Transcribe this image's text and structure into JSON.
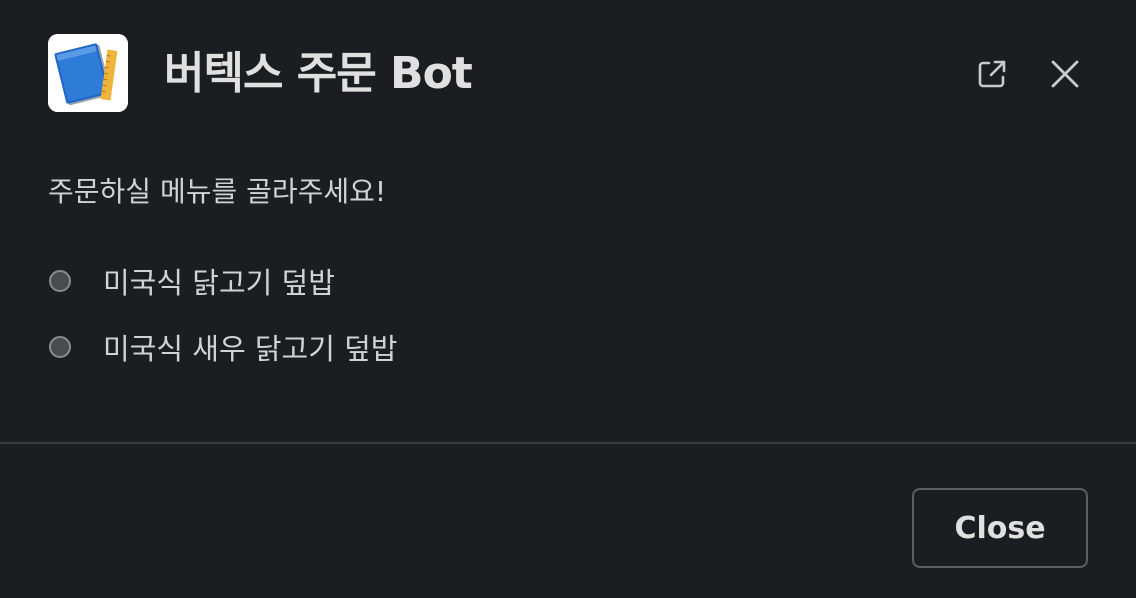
{
  "modal": {
    "title": "버텍스 주문 Bot",
    "app_icon": "notebook-ruler-icon",
    "header_actions": [
      {
        "icon": "open-external-icon"
      },
      {
        "icon": "close-icon"
      }
    ]
  },
  "body": {
    "prompt": "주문하실 메뉴를 골라주세요!",
    "options": [
      {
        "label": "미국식 닭고기 덮밥"
      },
      {
        "label": "미국식 새우 닭고기 덮밥"
      }
    ]
  },
  "footer": {
    "close_label": "Close"
  },
  "colors": {
    "background": "#1b1d21",
    "text": "#d1d2d3",
    "divider": "#3a3b3e",
    "icon_blue": "#2f7bd8",
    "icon_ruler": "#f0b43c"
  }
}
